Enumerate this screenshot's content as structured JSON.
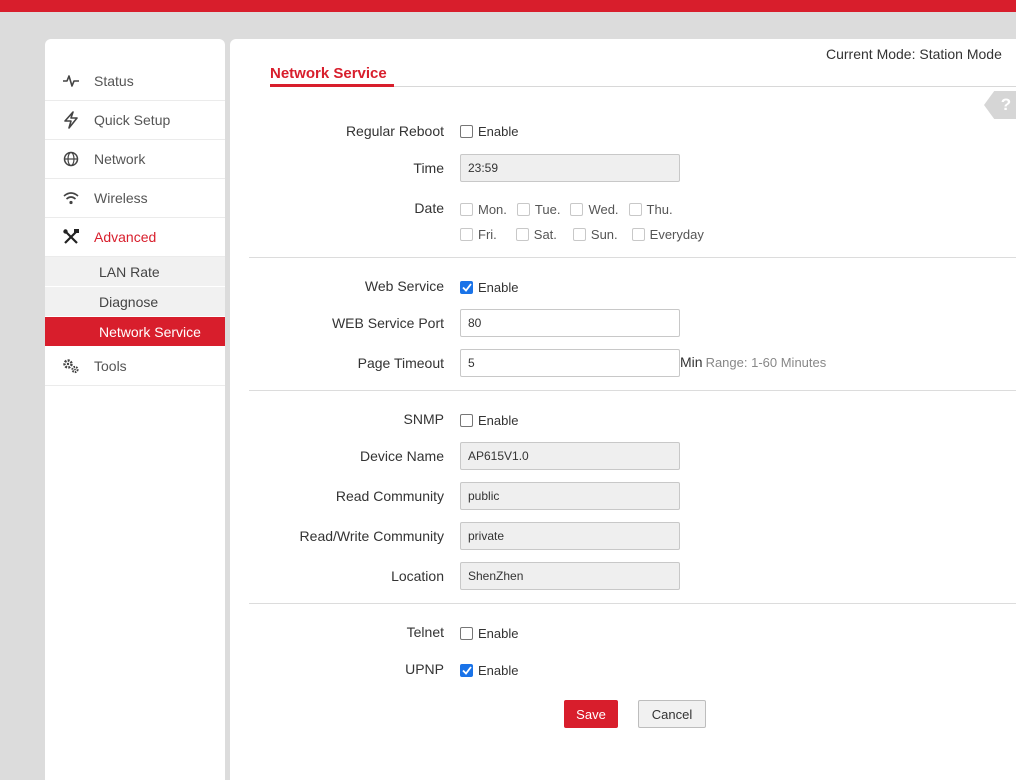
{
  "colors": {
    "accent": "#d81e2c",
    "check_blue": "#1a73e8"
  },
  "header": {
    "mode_text": "Current Mode: Station Mode"
  },
  "sidebar": {
    "items": [
      {
        "label": "Status",
        "icon": "pulse-icon"
      },
      {
        "label": "Quick Setup",
        "icon": "lightning-icon"
      },
      {
        "label": "Network",
        "icon": "globe-icon"
      },
      {
        "label": "Wireless",
        "icon": "wifi-icon"
      },
      {
        "label": "Advanced",
        "icon": "tools-icon"
      },
      {
        "label": "Tools",
        "icon": "gears-icon"
      }
    ],
    "sub_items": [
      {
        "label": "LAN Rate"
      },
      {
        "label": "Diagnose"
      },
      {
        "label": "Network Service"
      }
    ]
  },
  "page": {
    "title": "Network Service",
    "help": "?"
  },
  "form": {
    "regular_reboot": {
      "label": "Regular Reboot",
      "enable": "Enable",
      "checked": false
    },
    "time": {
      "label": "Time",
      "value": "23:59"
    },
    "date": {
      "label": "Date",
      "days_row1": [
        "Mon.",
        "Tue.",
        "Wed.",
        "Thu."
      ],
      "days_row2": [
        "Fri.",
        "Sat.",
        "Sun.",
        "Everyday"
      ]
    },
    "web_service": {
      "label": "Web Service",
      "enable": "Enable",
      "checked": true
    },
    "web_port": {
      "label": "WEB Service Port",
      "value": "80"
    },
    "page_timeout": {
      "label": "Page Timeout",
      "value": "5",
      "unit": "Min",
      "hint": "Range: 1-60 Minutes"
    },
    "snmp": {
      "label": "SNMP",
      "enable": "Enable",
      "checked": false
    },
    "device_name": {
      "label": "Device Name",
      "value": "AP615V1.0"
    },
    "read_community": {
      "label": "Read Community",
      "value": "public"
    },
    "rw_community": {
      "label": "Read/Write Community",
      "value": "private"
    },
    "location": {
      "label": "Location",
      "value": "ShenZhen"
    },
    "telnet": {
      "label": "Telnet",
      "enable": "Enable",
      "checked": false
    },
    "upnp": {
      "label": "UPNP",
      "enable": "Enable",
      "checked": true
    }
  },
  "buttons": {
    "save": "Save",
    "cancel": "Cancel"
  }
}
